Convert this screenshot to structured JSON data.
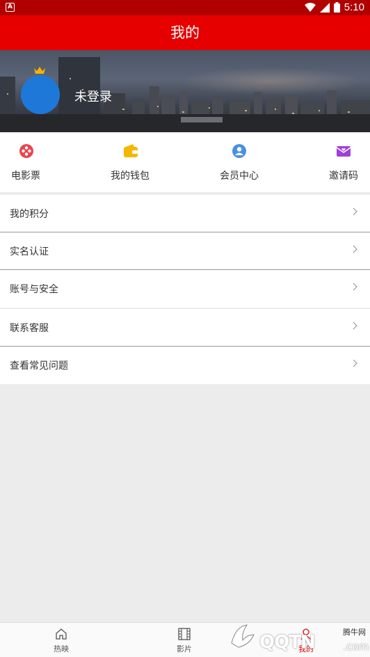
{
  "status_bar": {
    "time": "5:10",
    "notification_glyph": "A"
  },
  "app_bar": {
    "title": "我的"
  },
  "profile": {
    "login_label": "未登录",
    "avatar_color": "#1e78d8"
  },
  "quick_menu": [
    {
      "label": "电影票",
      "icon": "film-reel-icon",
      "color": "#e8474f"
    },
    {
      "label": "我的钱包",
      "icon": "wallet-icon",
      "color": "#f5b800"
    },
    {
      "label": "会员中心",
      "icon": "member-icon",
      "color": "#4a90e2"
    },
    {
      "label": "邀请码",
      "icon": "envelope-heart-icon",
      "color": "#a040d8"
    }
  ],
  "menu_groups": [
    [
      "我的积分",
      "实名认证",
      "账号与安全"
    ],
    [
      "联系客服",
      "查看常见问题"
    ]
  ],
  "tab_bar": {
    "tabs": [
      "热映",
      "影片",
      "我的"
    ]
  },
  "watermark": {
    "brand": "QQTN",
    "suffix": ".com",
    "site": "腾牛网"
  },
  "colors": {
    "primary": "#e60000",
    "status_bar": "#b00000"
  }
}
